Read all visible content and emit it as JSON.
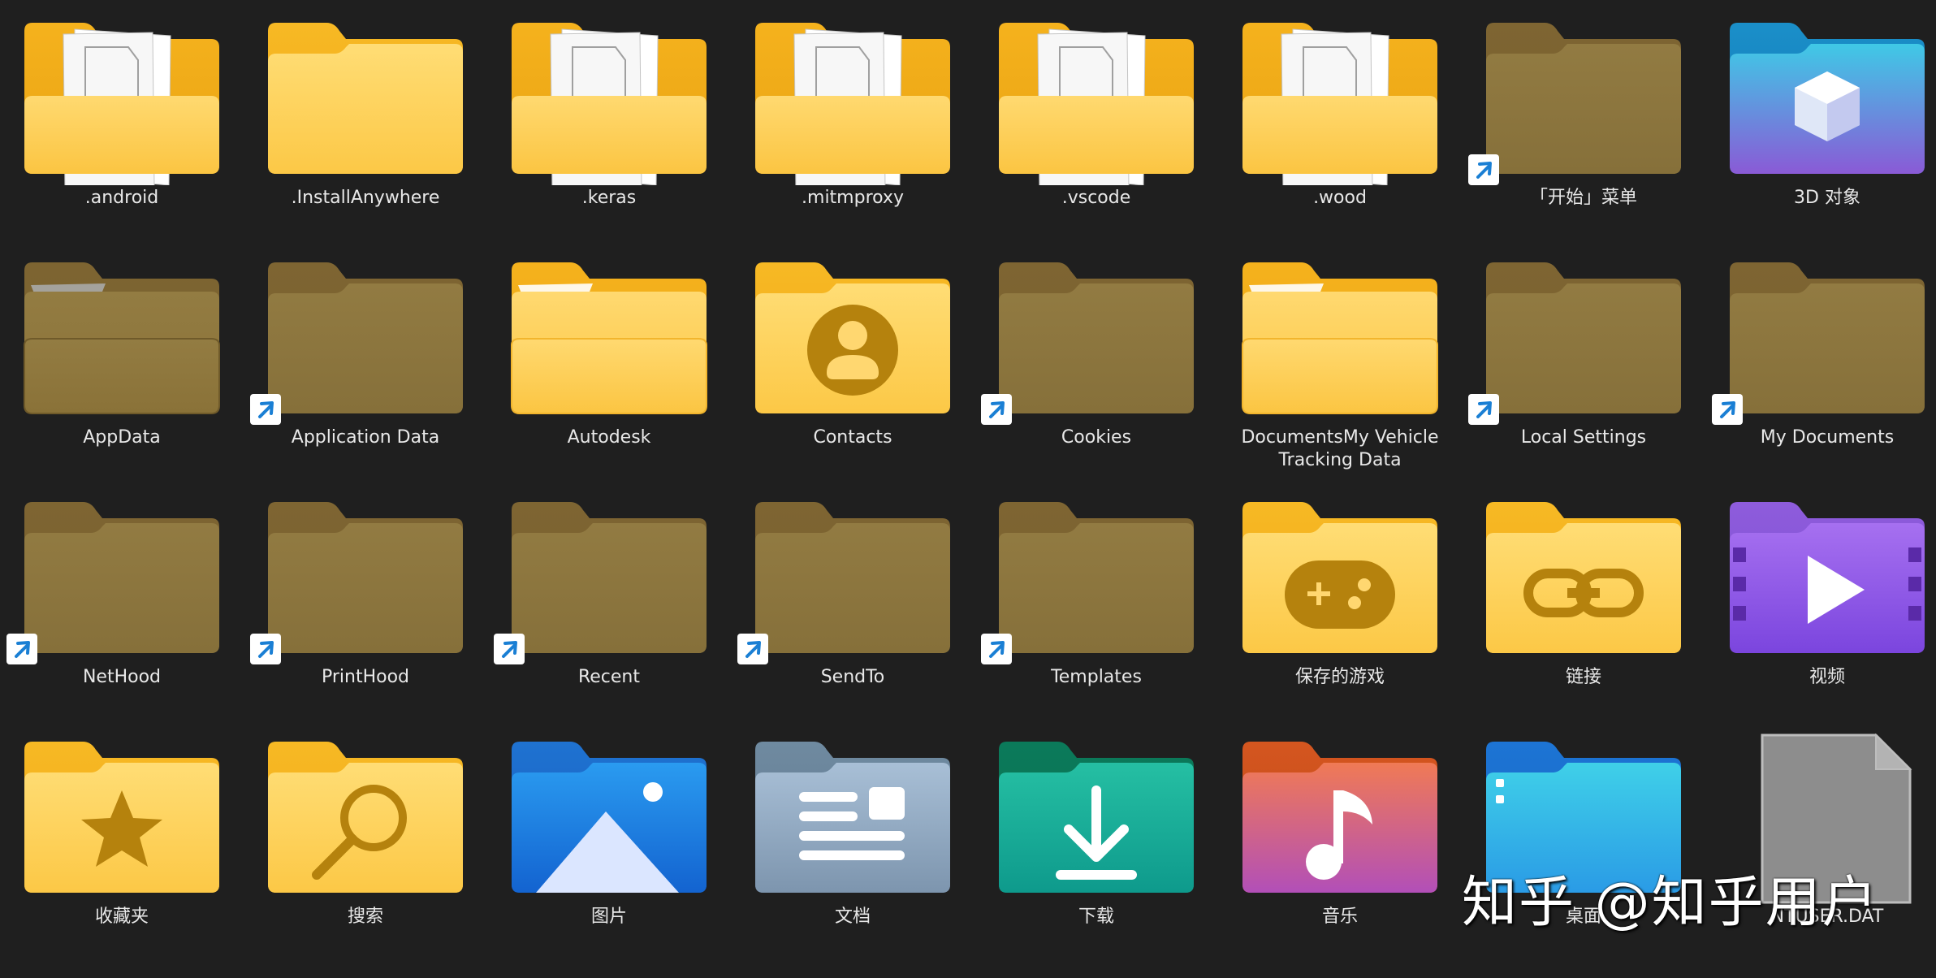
{
  "items": [
    {
      "label": ".android",
      "icon": "folder-with-pages-icon",
      "style": "pages",
      "shortcut": false
    },
    {
      "label": ".InstallAnywhere",
      "icon": "folder-icon",
      "style": "plain",
      "shortcut": false
    },
    {
      "label": ".keras",
      "icon": "folder-with-pages-icon",
      "style": "pages",
      "shortcut": false
    },
    {
      "label": ".mitmproxy",
      "icon": "folder-with-pages-icon",
      "style": "pages",
      "shortcut": false
    },
    {
      "label": ".vscode",
      "icon": "folder-with-pages-icon",
      "style": "pages",
      "shortcut": false
    },
    {
      "label": ".wood",
      "icon": "folder-with-pages-icon",
      "style": "pages",
      "shortcut": false
    },
    {
      "label": "「开始」菜单",
      "icon": "hidden-folder-icon",
      "style": "hidden",
      "shortcut": true
    },
    {
      "label": "3D 对象",
      "icon": "3d-objects-folder-icon",
      "style": "3d",
      "shortcut": false
    },
    {
      "label": "AppData",
      "icon": "hidden-folder-icon",
      "style": "hidden-open",
      "shortcut": false
    },
    {
      "label": "Application Data",
      "icon": "hidden-folder-icon",
      "style": "hidden",
      "shortcut": true
    },
    {
      "label": "Autodesk",
      "icon": "folder-open-icon",
      "style": "open",
      "shortcut": false
    },
    {
      "label": "Contacts",
      "icon": "contacts-folder-icon",
      "style": "contacts",
      "shortcut": false
    },
    {
      "label": "Cookies",
      "icon": "hidden-folder-icon",
      "style": "hidden",
      "shortcut": true
    },
    {
      "label": "DocumentsMy Vehicle Tracking Data",
      "icon": "folder-open-icon",
      "style": "open",
      "shortcut": false
    },
    {
      "label": "Local Settings",
      "icon": "hidden-folder-icon",
      "style": "hidden",
      "shortcut": true
    },
    {
      "label": "My Documents",
      "icon": "hidden-folder-icon",
      "style": "hidden",
      "shortcut": true
    },
    {
      "label": "NetHood",
      "icon": "hidden-folder-icon",
      "style": "hidden",
      "shortcut": true
    },
    {
      "label": "PrintHood",
      "icon": "hidden-folder-icon",
      "style": "hidden",
      "shortcut": true
    },
    {
      "label": "Recent",
      "icon": "hidden-folder-icon",
      "style": "hidden",
      "shortcut": true
    },
    {
      "label": "SendTo",
      "icon": "hidden-folder-icon",
      "style": "hidden",
      "shortcut": true
    },
    {
      "label": "Templates",
      "icon": "hidden-folder-icon",
      "style": "hidden",
      "shortcut": true
    },
    {
      "label": "保存的游戏",
      "icon": "saved-games-folder-icon",
      "style": "games",
      "shortcut": false
    },
    {
      "label": "链接",
      "icon": "links-folder-icon",
      "style": "links",
      "shortcut": false
    },
    {
      "label": "视频",
      "icon": "videos-folder-icon",
      "style": "videos",
      "shortcut": false
    },
    {
      "label": "收藏夹",
      "icon": "favorites-folder-icon",
      "style": "favorites",
      "shortcut": false
    },
    {
      "label": "搜索",
      "icon": "searches-folder-icon",
      "style": "search",
      "shortcut": false
    },
    {
      "label": "图片",
      "icon": "pictures-folder-icon",
      "style": "pictures",
      "shortcut": false
    },
    {
      "label": "文档",
      "icon": "documents-folder-icon",
      "style": "documents",
      "shortcut": false
    },
    {
      "label": "下载",
      "icon": "downloads-folder-icon",
      "style": "downloads",
      "shortcut": false
    },
    {
      "label": "音乐",
      "icon": "music-folder-icon",
      "style": "music",
      "shortcut": false
    },
    {
      "label": "桌面",
      "icon": "desktop-folder-icon",
      "style": "desktop",
      "shortcut": false
    },
    {
      "label": "NTUSER.DAT",
      "icon": "file-icon",
      "style": "file",
      "shortcut": false
    }
  ],
  "watermark": "知乎 @知乎用户",
  "colors": {
    "background": "#1f1f1f",
    "folder_back": "#f7b924",
    "folder_front": "#fdd66a",
    "hidden_folder": "#8b7336",
    "accent_blue": "#1a7fd4"
  }
}
